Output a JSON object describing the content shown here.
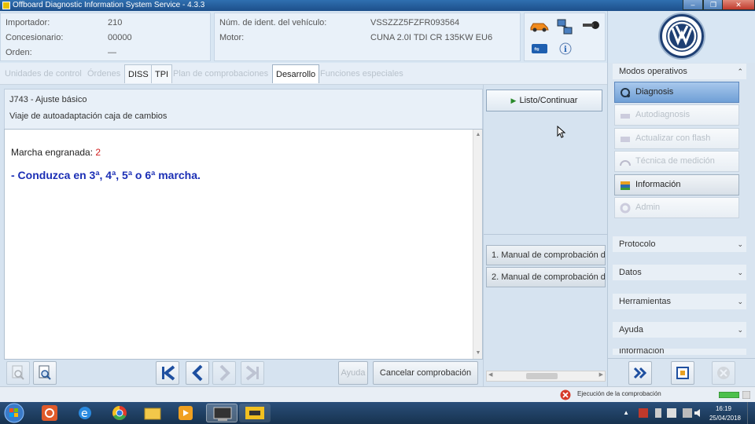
{
  "window": {
    "title": "Offboard Diagnostic Information System Service - 4.3.3",
    "controls": [
      "minimize",
      "restore",
      "close"
    ]
  },
  "header": {
    "importador_label": "Importador:",
    "importador_value": "210",
    "concesionario_label": "Concesionario:",
    "concesionario_value": "00000",
    "orden_label": "Orden:",
    "orden_value": "—",
    "vin_label": "Núm. de ident. del vehículo:",
    "vin_value": "VSSZZZ5FZFR093564",
    "motor_label": "Motor:",
    "motor_value": "CUNA 2.0I TDI CR 135KW EU6"
  },
  "tabs": [
    {
      "label": "Unidades de control",
      "state": "disabled"
    },
    {
      "label": "Órdenes",
      "state": "disabled"
    },
    {
      "label": "DISS",
      "state": "enabled"
    },
    {
      "label": "TPI",
      "state": "enabled"
    },
    {
      "label": "Plan de comprobaciones",
      "state": "disabled"
    },
    {
      "label": "Desarrollo",
      "state": "active"
    },
    {
      "label": "Funciones especiales",
      "state": "disabled"
    }
  ],
  "procedure": {
    "code_title": "J743 - Ajuste básico",
    "subtitle": "Viaje de autoadaptación caja de cambios",
    "gear_label": "Marcha engranada:",
    "gear_value": "2",
    "instruction": "- Conduzca en 3ª, 4ª, 5ª o 6ª marcha."
  },
  "bottom_buttons": {
    "ayuda": "Ayuda",
    "cancelar": "Cancelar comprobación"
  },
  "actions": {
    "listo": "Listo/Continuar",
    "manual1": "1. Manual de comprobación d",
    "manual2": "2. Manual de comprobación d"
  },
  "sidebar": {
    "modos_title": "Modos operativos",
    "modes": [
      {
        "label": "Diagnosis",
        "state": "active",
        "icon": "stethoscope-icon"
      },
      {
        "label": "Autodiagnosis",
        "state": "disabled",
        "icon": "car-diagnosis-icon"
      },
      {
        "label": "Actualizar con flash",
        "state": "disabled",
        "icon": "flash-update-icon"
      },
      {
        "label": "Técnica de medición",
        "state": "disabled",
        "icon": "measurement-icon"
      },
      {
        "label": "Información",
        "state": "enabled",
        "icon": "books-icon"
      },
      {
        "label": "Admin",
        "state": "disabled",
        "icon": "admin-gear-icon"
      }
    ],
    "sections": [
      "Protocolo",
      "Datos",
      "Herramientas",
      "Ayuda",
      "Información"
    ]
  },
  "status": {
    "message": "Ejecución de la comprobación"
  },
  "taskbar": {
    "time": "16:19",
    "date": "25/04/2018"
  },
  "colors": {
    "accent_blue": "#1b2fb5",
    "gear_red": "#d21c1c",
    "active_mode": "#6f9fd6"
  }
}
